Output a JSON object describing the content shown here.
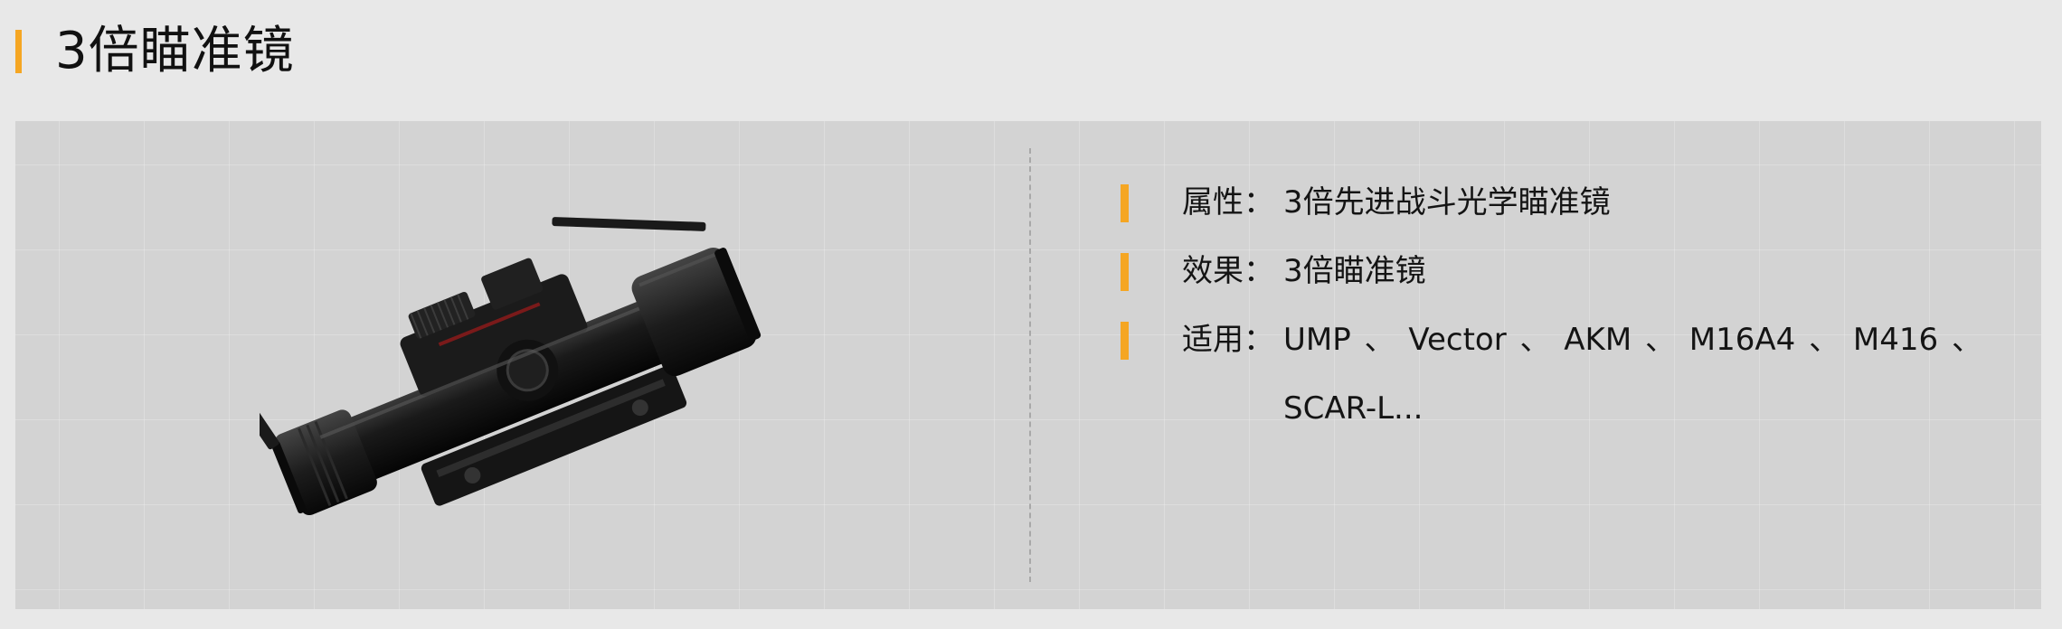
{
  "header": {
    "title": "3倍瞄准镜"
  },
  "item": {
    "image_name": "3x-scope-image",
    "attributes": [
      {
        "label": "属性：",
        "value": "3倍先进战斗光学瞄准镜"
      },
      {
        "label": "效果：",
        "value": "3倍瞄准镜"
      },
      {
        "label": "适用：",
        "value": "UMP 、 Vector 、  AKM 、 M16A4 、 M416 、 SCAR-L..."
      }
    ]
  },
  "colors": {
    "accent": "#f5a623",
    "background": "#e8e8e8",
    "card": "#d3d3d3"
  }
}
